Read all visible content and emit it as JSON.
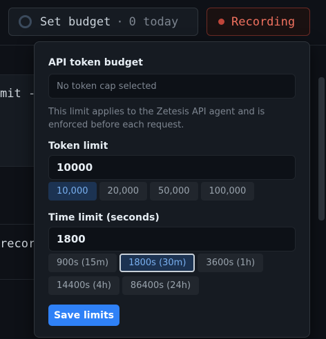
{
  "topbar": {
    "budget_label": "Set budget",
    "budget_separator": "·",
    "budget_today": "0 today",
    "recording_label": "Recording"
  },
  "background": {
    "line1": "mit -m",
    "line2": "record"
  },
  "popover": {
    "title": "API token budget",
    "budget_select_placeholder": "No token cap selected",
    "help_text": "This limit applies to the Zetesis API agent and is enforced before each request.",
    "token_section": {
      "label": "Token limit",
      "value": "10000",
      "presets": [
        "10,000",
        "20,000",
        "50,000",
        "100,000"
      ],
      "selected_index": 0
    },
    "time_section": {
      "label": "Time limit (seconds)",
      "value": "1800",
      "presets": [
        "900s (15m)",
        "1800s (30m)",
        "3600s (1h)",
        "14400s (4h)",
        "86400s (24h)"
      ],
      "selected_index": 1
    },
    "save_label": "Save limits"
  },
  "colors": {
    "accent": "#2f81f7",
    "recording": "#f0715f",
    "selected_chip": "#1c3352"
  }
}
